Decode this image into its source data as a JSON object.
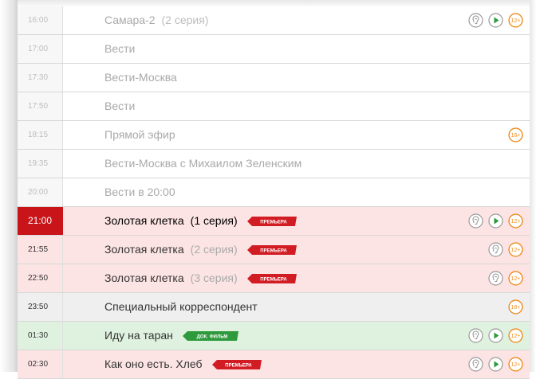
{
  "schedule": [
    {
      "time": "16:00",
      "title": "Самара-2",
      "episode": "(2 серия)",
      "style": "past",
      "badge": "",
      "icons": [
        "ear-icon",
        "play-icon",
        "age-12-icon"
      ],
      "age": "12+"
    },
    {
      "time": "17:00",
      "title": "Вести",
      "episode": "",
      "style": "past",
      "badge": "",
      "icons": [],
      "age": ""
    },
    {
      "time": "17:30",
      "title": "Вести-Москва",
      "episode": "",
      "style": "past",
      "badge": "",
      "icons": [],
      "age": ""
    },
    {
      "time": "17:50",
      "title": "Вести",
      "episode": "",
      "style": "past",
      "badge": "",
      "icons": [],
      "age": ""
    },
    {
      "time": "18:15",
      "title": "Прямой эфир",
      "episode": "",
      "style": "past",
      "badge": "",
      "icons": [
        "age-16-icon"
      ],
      "age": "16+"
    },
    {
      "time": "19:35",
      "title": "Вести-Москва с Михаилом Зеленским",
      "episode": "",
      "style": "past",
      "badge": "",
      "icons": [],
      "age": ""
    },
    {
      "time": "20:00",
      "title": "Вести в 20:00",
      "episode": "",
      "style": "past",
      "badge": "",
      "icons": [],
      "age": ""
    },
    {
      "time": "21:00",
      "title": "Золотая клетка",
      "episode": "(1 серия)",
      "style": "now",
      "badge": "ПРЕМЬЕРА",
      "icons": [
        "ear-icon",
        "play-icon",
        "age-12-icon"
      ],
      "age": "12+"
    },
    {
      "time": "21:55",
      "title": "Золотая клетка",
      "episode": "(2 серия)",
      "style": "red",
      "badge": "ПРЕМЬЕРА",
      "icons": [
        "ear-icon",
        "age-12-icon"
      ],
      "age": "12+"
    },
    {
      "time": "22:50",
      "title": "Золотая клетка",
      "episode": "(3 серия)",
      "style": "red",
      "badge": "ПРЕМЬЕРА",
      "icons": [
        "ear-icon",
        "age-12-icon"
      ],
      "age": "12+"
    },
    {
      "time": "23:50",
      "title": "Специальный корреспондент",
      "episode": "",
      "style": "gray",
      "badge": "",
      "icons": [
        "age-16-icon"
      ],
      "age": "16+"
    },
    {
      "time": "01:30",
      "title": "Иду на таран",
      "episode": "",
      "style": "green",
      "badge": "ДОК. ФИЛЬМ",
      "icons": [
        "ear-icon",
        "play-icon",
        "age-12-icon"
      ],
      "age": "12+"
    },
    {
      "time": "02:30",
      "title": "Как оно есть. Хлеб",
      "episode": "",
      "style": "red",
      "badge": "ПРЕМЬЕРА",
      "icons": [
        "ear-icon",
        "play-icon",
        "age-12-icon"
      ],
      "age": "12+"
    }
  ],
  "colors": {
    "now_time_bg": "#c9141a",
    "premiere_badge": "#d21c24",
    "doc_badge": "#2e9a3c",
    "play_icon": "#2e9a3c",
    "age_icon": "#f08a1c",
    "ear_icon": "#9a9a9a"
  }
}
